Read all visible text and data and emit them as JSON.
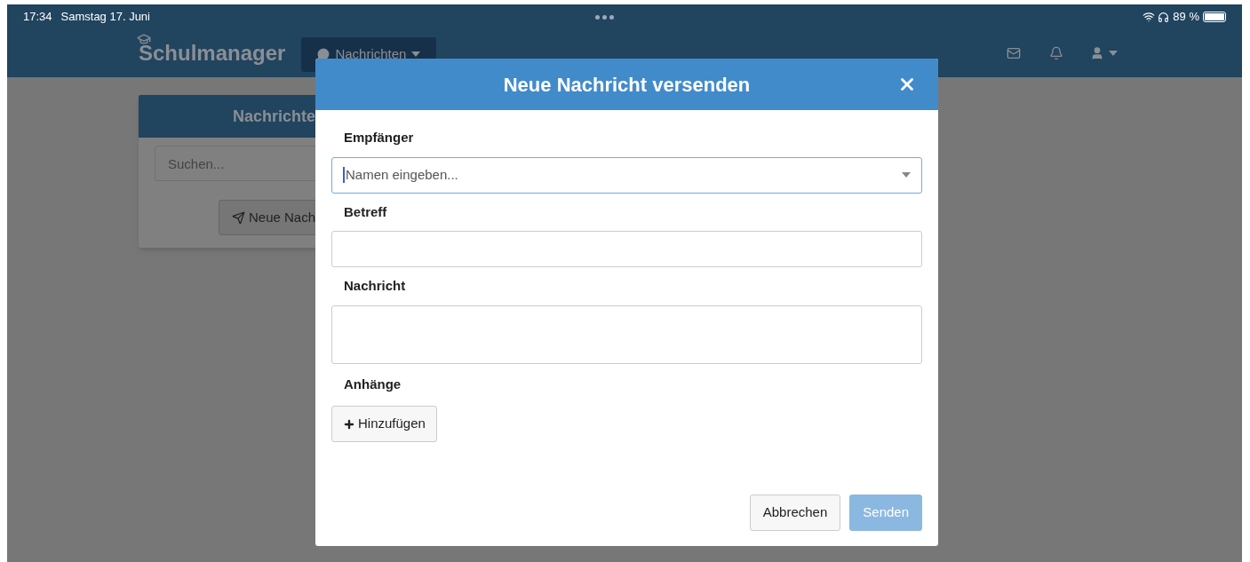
{
  "status_bar": {
    "time": "17:34",
    "date": "Samstag 17. Juni",
    "battery": "89 %"
  },
  "nav": {
    "logo": "Schulmanager",
    "menu_button": "Nachrichten"
  },
  "panel": {
    "title": "Nachrichte",
    "search": {
      "placeholder": "Suchen..."
    },
    "button": "Neue Nach"
  },
  "modal": {
    "title": "Neue Nachricht versenden",
    "fields": [
      {
        "label": "Empfänger",
        "kind": "select",
        "placeholder": "Namen eingeben...",
        "focused": true
      },
      {
        "label": "Betreff",
        "kind": "text",
        "focused": false
      },
      {
        "label": "Nachricht",
        "kind": "textarea",
        "focused": false
      }
    ],
    "attachments": {
      "label": "Anhänge",
      "button": "Hinzufügen"
    },
    "buttons": [
      {
        "label": "Abbrechen",
        "kind": "secondary",
        "disabled": false
      },
      {
        "label": "Senden",
        "kind": "primary",
        "disabled": true
      }
    ]
  }
}
